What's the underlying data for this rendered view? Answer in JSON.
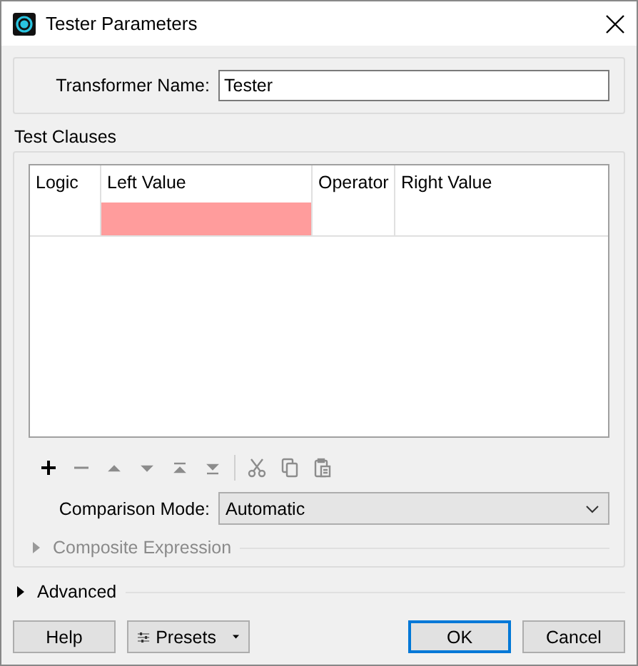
{
  "window": {
    "title": "Tester Parameters"
  },
  "transformer_name": {
    "label": "Transformer Name:",
    "value": "Tester"
  },
  "test_clauses": {
    "title": "Test Clauses",
    "columns": [
      "Logic",
      "Left Value",
      "Operator",
      "Right Value"
    ],
    "rows": [
      {
        "left_value_invalid": true
      }
    ],
    "toolbar": [
      {
        "kind": "add",
        "disabled": false
      },
      {
        "kind": "remove",
        "disabled": true
      },
      {
        "kind": "up",
        "disabled": true
      },
      {
        "kind": "down",
        "disabled": true
      },
      {
        "kind": "top",
        "disabled": true
      },
      {
        "kind": "bottom",
        "disabled": true
      },
      {
        "kind": "cut",
        "disabled": true
      },
      {
        "kind": "copy",
        "disabled": true
      },
      {
        "kind": "paste",
        "disabled": true
      }
    ],
    "comparison_mode": {
      "label": "Comparison Mode:",
      "value": "Automatic"
    },
    "composite_expression": {
      "label": "Composite Expression",
      "disabled": true,
      "expanded": false
    }
  },
  "advanced": {
    "label": "Advanced",
    "expanded": false
  },
  "buttons": [
    {
      "label": "Help",
      "kind": "plain",
      "default": false
    },
    {
      "label": "Presets",
      "kind": "menu",
      "default": false
    },
    {
      "label": "OK",
      "kind": "plain",
      "default": true
    },
    {
      "label": "Cancel",
      "kind": "plain",
      "default": false
    }
  ]
}
